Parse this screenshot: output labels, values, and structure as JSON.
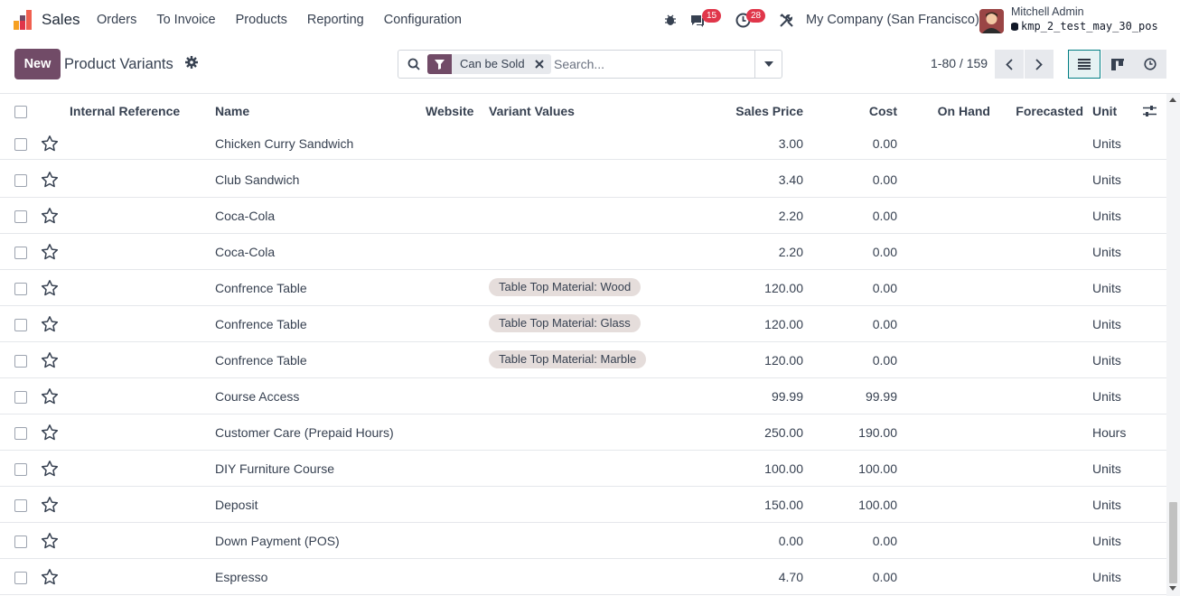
{
  "app": {
    "name": "Sales",
    "logo_icon": "sales-chart-logo-icon",
    "colors": {
      "brand": "#714b67",
      "accent": "#017e84",
      "badge": "#e0364a"
    }
  },
  "menu": [
    "Orders",
    "To Invoice",
    "Products",
    "Reporting",
    "Configuration"
  ],
  "systray": {
    "debug_icon": "bug-icon",
    "messages_badge": "15",
    "activities_badge": "28",
    "tools_icon": "tools-icon",
    "company": "My Company (San Francisco)",
    "user_name": "Mitchell Admin",
    "database": "kmp_2_test_may_30_pos"
  },
  "control": {
    "new_label": "New",
    "title": "Product Variants",
    "facet_label": "Can be Sold",
    "search_placeholder": "Search...",
    "pager": "1-80 / 159"
  },
  "columns": {
    "internal_ref": "Internal Reference",
    "name": "Name",
    "website": "Website",
    "variant_values": "Variant Values",
    "sales_price": "Sales Price",
    "cost": "Cost",
    "on_hand": "On Hand",
    "forecasted": "Forecasted",
    "unit": "Unit"
  },
  "rows": [
    {
      "name": "Chicken Curry Sandwich",
      "variant": "",
      "price": "3.00",
      "cost": "0.00",
      "unit": "Units"
    },
    {
      "name": "Club Sandwich",
      "variant": "",
      "price": "3.40",
      "cost": "0.00",
      "unit": "Units"
    },
    {
      "name": "Coca-Cola",
      "variant": "",
      "price": "2.20",
      "cost": "0.00",
      "unit": "Units"
    },
    {
      "name": "Coca-Cola",
      "variant": "",
      "price": "2.20",
      "cost": "0.00",
      "unit": "Units"
    },
    {
      "name": "Confrence Table",
      "variant": "Table Top Material: Wood",
      "price": "120.00",
      "cost": "0.00",
      "unit": "Units"
    },
    {
      "name": "Confrence Table",
      "variant": "Table Top Material: Glass",
      "price": "120.00",
      "cost": "0.00",
      "unit": "Units"
    },
    {
      "name": "Confrence Table",
      "variant": "Table Top Material: Marble",
      "price": "120.00",
      "cost": "0.00",
      "unit": "Units"
    },
    {
      "name": "Course Access",
      "variant": "",
      "price": "99.99",
      "cost": "99.99",
      "unit": "Units"
    },
    {
      "name": "Customer Care (Prepaid Hours)",
      "variant": "",
      "price": "250.00",
      "cost": "190.00",
      "unit": "Hours"
    },
    {
      "name": "DIY Furniture Course",
      "variant": "",
      "price": "100.00",
      "cost": "100.00",
      "unit": "Units"
    },
    {
      "name": "Deposit",
      "variant": "",
      "price": "150.00",
      "cost": "100.00",
      "unit": "Units"
    },
    {
      "name": "Down Payment (POS)",
      "variant": "",
      "price": "0.00",
      "cost": "0.00",
      "unit": "Units"
    },
    {
      "name": "Espresso",
      "variant": "",
      "price": "4.70",
      "cost": "0.00",
      "unit": "Units"
    }
  ]
}
